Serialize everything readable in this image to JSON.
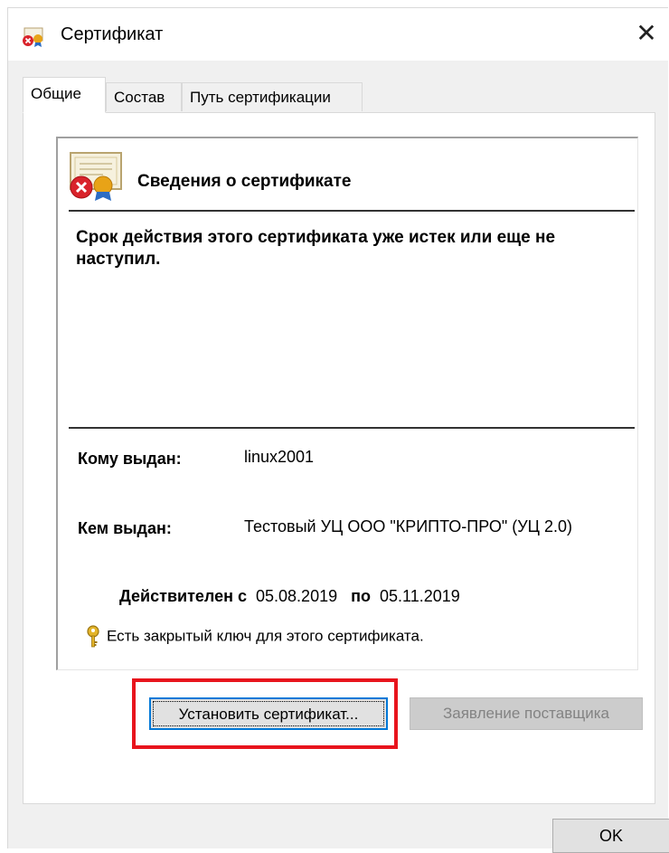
{
  "window": {
    "title": "Сертификат",
    "close_glyph": "✕"
  },
  "tabs": [
    {
      "label": "Общие",
      "active": true
    },
    {
      "label": "Состав",
      "active": false
    },
    {
      "label": "Путь сертификации",
      "active": false
    }
  ],
  "cert_info": {
    "heading": "Сведения о сертификате",
    "status": "Срок действия этого сертификата уже истек или еще не наступил.",
    "issued_to_label": "Кому выдан:",
    "issued_to_value": "linux2001",
    "issued_by_label": "Кем выдан:",
    "issued_by_value": "Тестовый УЦ ООО \"КРИПТО-ПРО\" (УЦ 2.0)",
    "valid_from_label": "Действителен с",
    "valid_from": "05.08.2019",
    "valid_to_label": "по",
    "valid_to": "05.11.2019",
    "private_key_note": "Есть закрытый ключ для этого сертификата."
  },
  "buttons": {
    "install": "Установить сертификат...",
    "issuer_statement": "Заявление поставщика",
    "ok": "OK"
  },
  "icons": {
    "window": "certificate-error-icon",
    "cert": "certificate-error-icon",
    "key": "key-icon",
    "close": "close-icon"
  },
  "colors": {
    "highlight": "#e8141d",
    "focus": "#0078d7",
    "error_badge": "#d9232b",
    "seal": "#e8a317"
  }
}
